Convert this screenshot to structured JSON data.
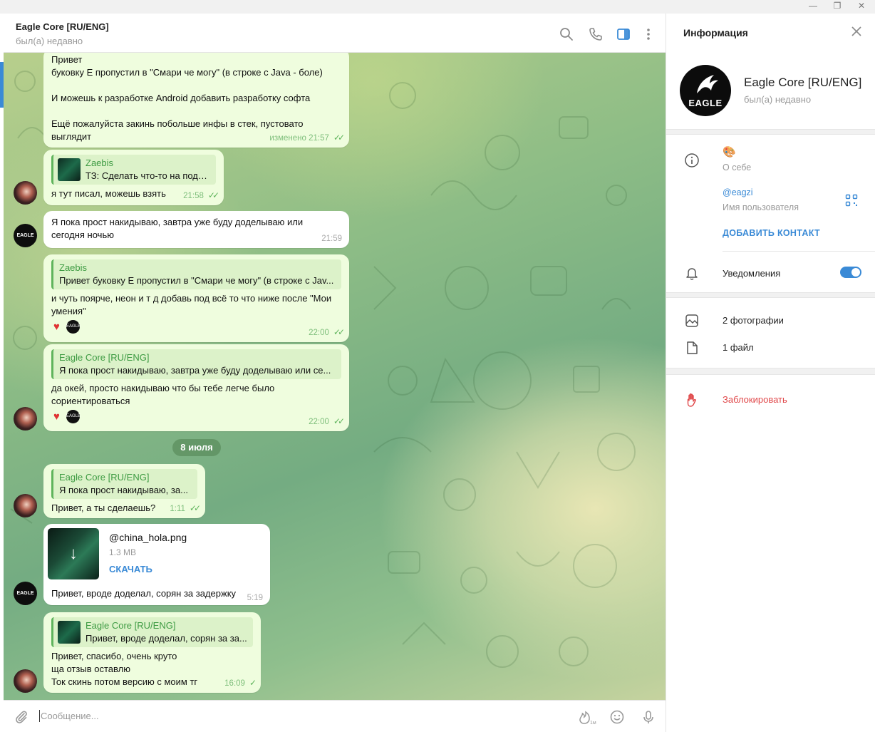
{
  "chat_header": {
    "title": "Eagle Core [RU/ENG]",
    "status": "был(а) недавно"
  },
  "messages": [
    {
      "text": "Привет\nбуковку Е пропустил в \"Смари че могу\" (в строке с Java - боле)\n\nИ можешь к разработке Android добавить разработку софта\n\nЕщё пожалуйста закинь побольше инфы в стек, пустовато\nвыглядит",
      "time": "изменено 21:57"
    },
    {
      "reply_name": "Zaebis",
      "reply_text": "ТЗ: Сделать что-то на подо...",
      "text": "я тут писал, можешь взять",
      "time": "21:58"
    },
    {
      "text": "Я пока прост накидываю, завтра уже буду доделываю или\nсегодня ночью",
      "time": "21:59"
    },
    {
      "reply_name": "Zaebis",
      "reply_text": "Привет буковку Е пропустил в \"Смари че могу\" (в строке с Jav...",
      "text": "и чуть поярче, неон и т д добавь под всё то что ниже после \"Мои\nумения\"",
      "time": "22:00"
    },
    {
      "reply_name": "Eagle Core [RU/ENG]",
      "reply_text": "Я пока прост накидываю, завтра уже буду доделываю или се...",
      "text": "да окей, просто накидываю что бы тебе легче было\nсориентироваться",
      "time": "22:00"
    },
    {
      "reply_name": "Eagle Core [RU/ENG]",
      "reply_text": "Я пока прост накидываю, за...",
      "text": "Привет, а ты сделаешь?",
      "time": "1:11"
    },
    {
      "file_name": "@china_hola.png",
      "file_size": "1.3 MB",
      "download": "СКАЧАТЬ",
      "text": "Привет, вроде доделал, сорян за задержку",
      "time": "5:19"
    },
    {
      "reply_name": "Eagle Core [RU/ENG]",
      "reply_text": "Привет, вроде доделал, сорян за за...",
      "text": "Привет, спасибо, очень круто\nща отзыв оставлю\nТок скинь потом версию с моим тг",
      "time": "16:09"
    }
  ],
  "date_separator": "8 июля",
  "avatar_label": "EAGLE",
  "input": {
    "placeholder": "Сообщение...",
    "voice_badge": "1м"
  },
  "info_panel": {
    "title": "Информация",
    "name": "Eagle Core [RU/ENG]",
    "status": "был(а) недавно",
    "avatar_text": "EAGLE",
    "bio_emoji": "🎨",
    "bio_label": "О себе",
    "username": "@eagzi",
    "username_label": "Имя пользователя",
    "add_contact": "ДОБАВИТЬ КОНТАКТ",
    "notifications": "Уведомления",
    "notifications_on": true,
    "photos": "2 фотографии",
    "files": "1 файл",
    "block": "Заблокировать"
  },
  "colors": {
    "accent": "#3a8ad6",
    "bubble": "#effdde",
    "danger": "#e0484a"
  }
}
